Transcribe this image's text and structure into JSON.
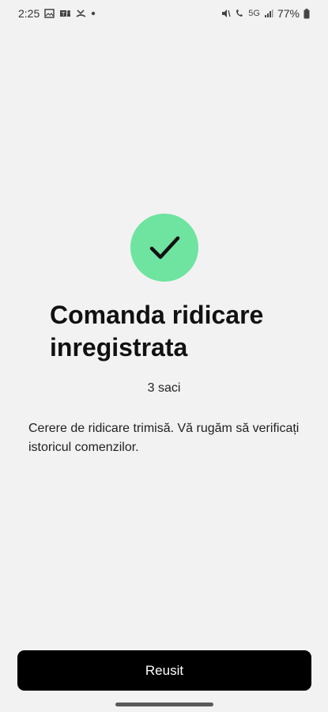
{
  "status_bar": {
    "time": "2:25",
    "battery_percent": "77%",
    "icons_left": [
      "gallery-icon",
      "teams-icon",
      "missed-call-icon",
      "dot-icon"
    ],
    "icons_right": [
      "mute-icon",
      "wifi-calling-icon",
      "5g-icon",
      "signal-icon",
      "battery-icon"
    ],
    "network_label": "5G"
  },
  "confirmation": {
    "icon": "checkmark-icon",
    "accent_color": "#6fe3a0",
    "title": "Comanda ridicare inregistrata",
    "bag_count": "3 saci",
    "message": "Cerere de ridicare trimisă. Vă rugăm să verificați istoricul comenzilor."
  },
  "actions": {
    "primary_label": "Reusit"
  }
}
